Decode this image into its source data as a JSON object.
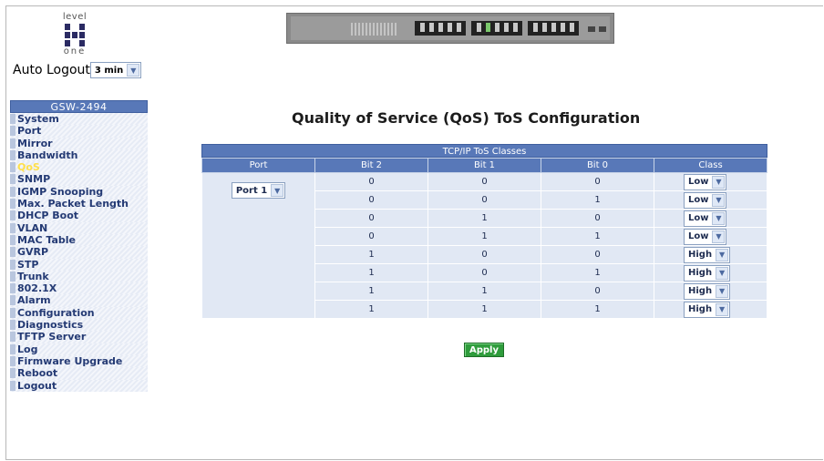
{
  "logo": {
    "top_text": "level",
    "bottom_text": "one"
  },
  "autologout": {
    "label": "Auto Logout",
    "value": "3 min"
  },
  "sidebar": {
    "header": "GSW-2494",
    "items": [
      {
        "label": "System",
        "active": false
      },
      {
        "label": "Port",
        "active": false
      },
      {
        "label": "Mirror",
        "active": false
      },
      {
        "label": "Bandwidth",
        "active": false
      },
      {
        "label": "QoS",
        "active": true
      },
      {
        "label": "SNMP",
        "active": false
      },
      {
        "label": "IGMP Snooping",
        "active": false
      },
      {
        "label": "Max. Packet Length",
        "active": false
      },
      {
        "label": "DHCP Boot",
        "active": false
      },
      {
        "label": "VLAN",
        "active": false
      },
      {
        "label": "MAC Table",
        "active": false
      },
      {
        "label": "GVRP",
        "active": false
      },
      {
        "label": "STP",
        "active": false
      },
      {
        "label": "Trunk",
        "active": false
      },
      {
        "label": "802.1X",
        "active": false
      },
      {
        "label": "Alarm",
        "active": false
      },
      {
        "label": "Configuration",
        "active": false
      },
      {
        "label": "Diagnostics",
        "active": false
      },
      {
        "label": "TFTP Server",
        "active": false
      },
      {
        "label": "Log",
        "active": false
      },
      {
        "label": "Firmware Upgrade",
        "active": false
      },
      {
        "label": "Reboot",
        "active": false
      },
      {
        "label": "Logout",
        "active": false
      }
    ]
  },
  "page": {
    "title": "Quality of Service (QoS) ToS Configuration"
  },
  "table": {
    "caption": "TCP/IP ToS Classes",
    "headers": [
      "Port",
      "Bit 2",
      "Bit 1",
      "Bit 0",
      "Class"
    ],
    "port_value": "Port 1",
    "rows": [
      {
        "bit2": "0",
        "bit1": "0",
        "bit0": "0",
        "class": "Low"
      },
      {
        "bit2": "0",
        "bit1": "0",
        "bit0": "1",
        "class": "Low"
      },
      {
        "bit2": "0",
        "bit1": "1",
        "bit0": "0",
        "class": "Low"
      },
      {
        "bit2": "0",
        "bit1": "1",
        "bit0": "1",
        "class": "Low"
      },
      {
        "bit2": "1",
        "bit1": "0",
        "bit0": "0",
        "class": "High"
      },
      {
        "bit2": "1",
        "bit1": "0",
        "bit0": "1",
        "class": "High"
      },
      {
        "bit2": "1",
        "bit1": "1",
        "bit0": "0",
        "class": "High"
      },
      {
        "bit2": "1",
        "bit1": "1",
        "bit0": "1",
        "class": "High"
      }
    ]
  },
  "apply_label": "Apply",
  "colors": {
    "header_blue": "#5878b8",
    "cell_bg": "#e1e8f4",
    "active_item": "#ffe04a",
    "apply_green": "#2f9c3c"
  }
}
